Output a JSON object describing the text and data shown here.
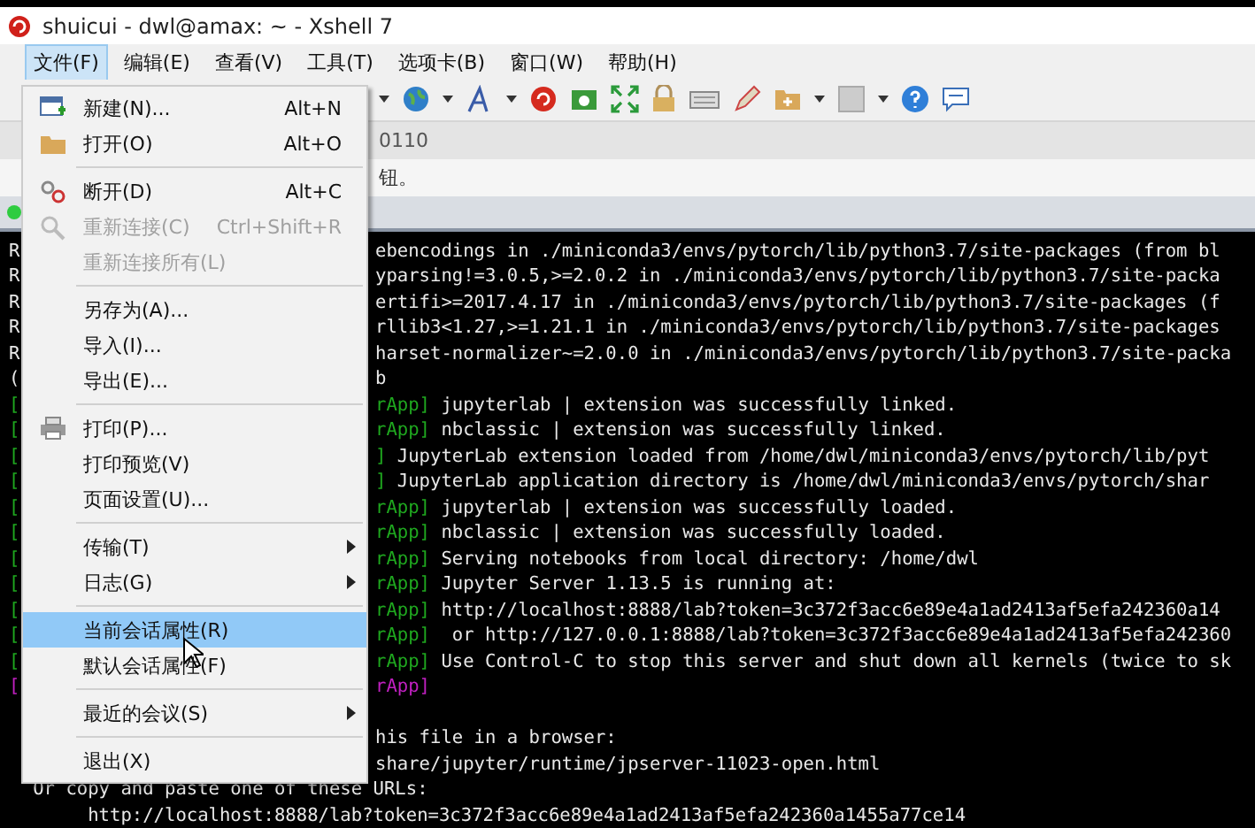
{
  "window": {
    "title": "shuicui - dwl@amax: ~ - Xshell 7"
  },
  "menubar": [
    {
      "label": "文件(F)",
      "selected": true
    },
    {
      "label": "编辑(E)",
      "selected": false
    },
    {
      "label": "查看(V)",
      "selected": false
    },
    {
      "label": "工具(T)",
      "selected": false
    },
    {
      "label": "选项卡(B)",
      "selected": false
    },
    {
      "label": "窗口(W)",
      "selected": false
    },
    {
      "label": "帮助(H)",
      "selected": false
    }
  ],
  "address_bar": {
    "text": "0110"
  },
  "info_bar": {
    "text": "钮。"
  },
  "file_menu": [
    {
      "kind": "item",
      "label": "新建(N)...",
      "shortcut": "Alt+N",
      "disabled": false,
      "selected": false,
      "submenu": false
    },
    {
      "kind": "item",
      "label": "打开(O)",
      "shortcut": "Alt+O",
      "disabled": false,
      "selected": false,
      "submenu": false
    },
    {
      "kind": "separator"
    },
    {
      "kind": "item",
      "label": "断开(D)",
      "shortcut": "Alt+C",
      "disabled": false,
      "selected": false,
      "submenu": false
    },
    {
      "kind": "item",
      "label": "重新连接(C)",
      "shortcut": "Ctrl+Shift+R",
      "disabled": true,
      "selected": false,
      "submenu": false
    },
    {
      "kind": "item",
      "label": "重新连接所有(L)",
      "disabled": true,
      "selected": false,
      "submenu": false
    },
    {
      "kind": "separator"
    },
    {
      "kind": "item",
      "label": "另存为(A)...",
      "disabled": false,
      "selected": false,
      "submenu": false
    },
    {
      "kind": "item",
      "label": "导入(I)...",
      "disabled": false,
      "selected": false,
      "submenu": false
    },
    {
      "kind": "item",
      "label": "导出(E)...",
      "disabled": false,
      "selected": false,
      "submenu": false
    },
    {
      "kind": "separator"
    },
    {
      "kind": "item",
      "label": "打印(P)...",
      "disabled": false,
      "selected": false,
      "submenu": false
    },
    {
      "kind": "item",
      "label": "打印预览(V)",
      "disabled": false,
      "selected": false,
      "submenu": false
    },
    {
      "kind": "item",
      "label": "页面设置(U)...",
      "disabled": false,
      "selected": false,
      "submenu": false
    },
    {
      "kind": "separator"
    },
    {
      "kind": "item",
      "label": "传输(T)",
      "disabled": false,
      "selected": false,
      "submenu": true
    },
    {
      "kind": "item",
      "label": "日志(G)",
      "disabled": false,
      "selected": false,
      "submenu": true
    },
    {
      "kind": "separator"
    },
    {
      "kind": "item",
      "label": "当前会话属性(R)",
      "disabled": false,
      "selected": true,
      "submenu": false
    },
    {
      "kind": "item",
      "label": "默认会话属性(F)",
      "disabled": false,
      "selected": false,
      "submenu": false
    },
    {
      "kind": "separator"
    },
    {
      "kind": "item",
      "label": "最近的会议(S)",
      "disabled": false,
      "selected": false,
      "submenu": true
    },
    {
      "kind": "separator"
    },
    {
      "kind": "item",
      "label": "退出(X)",
      "disabled": false,
      "selected": false,
      "submenu": false
    }
  ],
  "terminal": [
    {
      "left": "R",
      "text": "ebencodings in ./miniconda3/envs/pytorch/lib/python3.7/site-packages (from bl"
    },
    {
      "left": "R",
      "text": "yparsing!=3.0.5,>=2.0.2 in ./miniconda3/envs/pytorch/lib/python3.7/site-packa"
    },
    {
      "left": "R",
      "text": "ertifi>=2017.4.17 in ./miniconda3/envs/pytorch/lib/python3.7/site-packages (f"
    },
    {
      "left": "R",
      "text": "rllib3<1.27,>=1.21.1 in ./miniconda3/envs/pytorch/lib/python3.7/site-packages"
    },
    {
      "left": "R",
      "text": "harset-normalizer~=2.0.0 in ./miniconda3/envs/pytorch/lib/python3.7/site-packa"
    },
    {
      "left": "(",
      "text": "b"
    },
    {
      "left": "[",
      "tag": "rApp]",
      "color": "#1fa81f",
      "text": " jupyterlab | extension was successfully linked."
    },
    {
      "left": "[",
      "tag": "rApp]",
      "color": "#1fa81f",
      "text": " nbclassic | extension was successfully linked."
    },
    {
      "left": "[",
      "tag": "]",
      "color": "#1fa81f",
      "text": " JupyterLab extension loaded from /home/dwl/miniconda3/envs/pytorch/lib/pyt"
    },
    {
      "left": "[",
      "tag": "]",
      "color": "#1fa81f",
      "text": " JupyterLab application directory is /home/dwl/miniconda3/envs/pytorch/shar"
    },
    {
      "left": "[",
      "tag": "rApp]",
      "color": "#1fa81f",
      "text": " jupyterlab | extension was successfully loaded."
    },
    {
      "left": "[",
      "tag": "rApp]",
      "color": "#1fa81f",
      "text": " nbclassic | extension was successfully loaded."
    },
    {
      "left": "[",
      "tag": "rApp]",
      "color": "#1fa81f",
      "text": " Serving notebooks from local directory: /home/dwl"
    },
    {
      "left": "[",
      "tag": "rApp]",
      "color": "#1fa81f",
      "text": " Jupyter Server 1.13.5 is running at:"
    },
    {
      "left": "[",
      "tag": "rApp]",
      "color": "#1fa81f",
      "text": " http://localhost:8888/lab?token=3c372f3acc6e89e4a1ad2413af5efa242360a14"
    },
    {
      "left": "[",
      "tag": "rApp]",
      "color": "#1fa81f",
      "text": "  or http://127.0.0.1:8888/lab?token=3c372f3acc6e89e4a1ad2413af5efa242360"
    },
    {
      "left": "[",
      "tag": "rApp]",
      "color": "#1fa81f",
      "text": " Use Control-C to stop this server and shut down all kernels (twice to sk"
    },
    {
      "left": "[",
      "tag": "rApp]",
      "color": "#c020c0"
    },
    {
      "kind": "blank"
    },
    {
      "text": "his file in a browser:"
    },
    {
      "text": "share/jupyter/runtime/jpserver-11023-open.html"
    },
    {
      "full": "   Or copy and paste one of these URLs:"
    },
    {
      "full": "        http://localhost:8888/lab?token=3c372f3acc6e89e4a1ad2413af5efa242360a1455a77ce14"
    }
  ]
}
